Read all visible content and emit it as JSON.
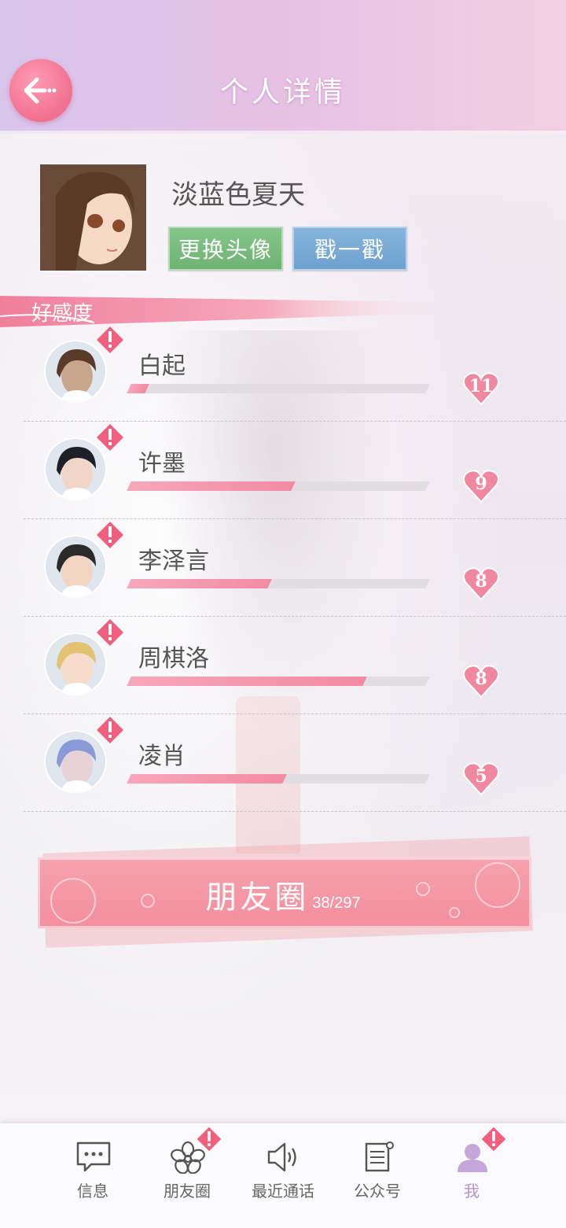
{
  "header": {
    "title": "个人详情",
    "back_icon": "arrow-left-icon"
  },
  "profile": {
    "username": "淡蓝色夏天",
    "change_avatar_label": "更换头像",
    "poke_label": "戳一戳"
  },
  "affection": {
    "section_label": "好感度",
    "characters": [
      {
        "name": "白起",
        "level": "11",
        "progress": 0.06
      },
      {
        "name": "许墨",
        "level": "9",
        "progress": 0.55
      },
      {
        "name": "李泽言",
        "level": "8",
        "progress": 0.47
      },
      {
        "name": "周棋洛",
        "level": "8",
        "progress": 0.79
      },
      {
        "name": "凌肖",
        "level": "5",
        "progress": 0.52
      }
    ]
  },
  "moments": {
    "label": "朋友圈",
    "count": "38/297"
  },
  "tabbar": {
    "items": [
      {
        "label": "信息",
        "icon": "message-icon"
      },
      {
        "label": "朋友圈",
        "icon": "sakura-icon"
      },
      {
        "label": "最近通话",
        "icon": "speaker-icon"
      },
      {
        "label": "公众号",
        "icon": "document-icon"
      },
      {
        "label": "我",
        "icon": "person-icon"
      }
    ]
  },
  "colors": {
    "accent_pink": "#f28aa3",
    "header_gradient_start": "#d8c5ec",
    "header_gradient_end": "#f3cfe2",
    "green_button": "#6eb374",
    "blue_button": "#6ea1cf",
    "active_tab": "#b692cf"
  }
}
